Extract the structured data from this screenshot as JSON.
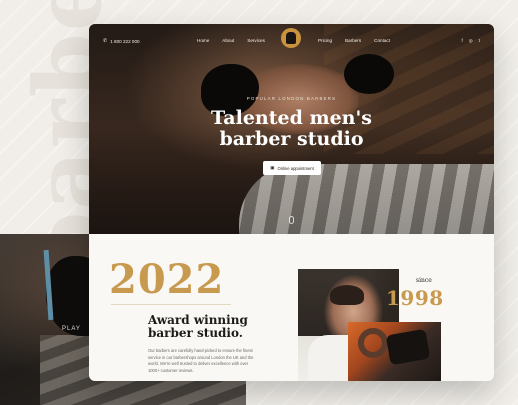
{
  "background": {
    "word": "barber",
    "play_label": "PLAY"
  },
  "nav": {
    "phone": "1 800 222 000",
    "phone_icon": "phone-icon",
    "menu_left": [
      "Home",
      "About",
      "Services"
    ],
    "menu_right": [
      "Pricing",
      "Barbers",
      "Contact"
    ],
    "social_icons": [
      "facebook-icon",
      "instagram-icon",
      "twitter-icon"
    ],
    "social_glyphs": [
      "f",
      "◎",
      "t"
    ]
  },
  "hero": {
    "eyebrow": "POPULAR LONDON BARBERS",
    "headline_line1": "Talented men's",
    "headline_line2": "barber studio",
    "cta_label": "Online appointment",
    "cta_icon": "calendar-icon"
  },
  "about": {
    "year": "2022",
    "title_line1": "Award winning",
    "title_line2": "barber studio.",
    "description": "Our barbers are carefully hand-picked to ensure the finest service in our barbershops around London the UK and the world. We're well trusted to deliver excellence with over 1000+ customer reviews.",
    "since_label": "since",
    "since_year": "1998"
  },
  "colors": {
    "accent": "#c79a50",
    "page_background": "#f1eee9",
    "card_background": "#faf8f4"
  }
}
